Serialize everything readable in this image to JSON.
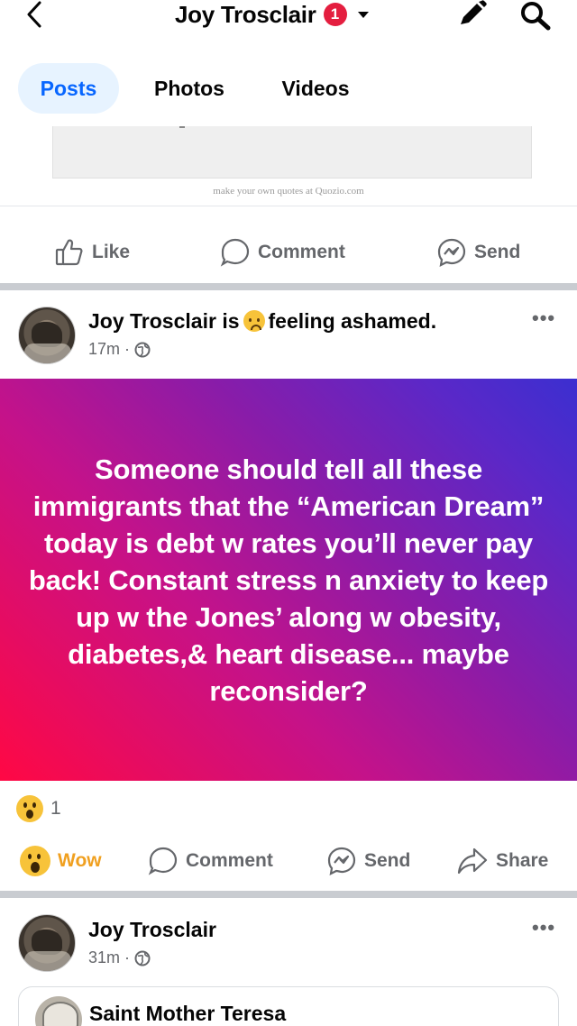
{
  "header": {
    "title": "Joy Trosclair",
    "notification_count": "1"
  },
  "tabs": [
    "Posts",
    "Photos",
    "Videos"
  ],
  "previous_post": {
    "credit": "make your own quotes at Quozio.com",
    "actions": {
      "like": "Like",
      "comment": "Comment",
      "send": "Send"
    }
  },
  "post1": {
    "author": "Joy Trosclair",
    "is_text": "is",
    "feeling": "feeling ashamed.",
    "time": "17m ·",
    "body": "Someone should tell all these immigrants that the “American Dream” today is debt w rates you’ll never pay back! Constant stress n anxiety to keep up w the Jones’ along w obesity, diabetes,& heart disease... maybe reconsider?",
    "reaction_count": "1",
    "actions": {
      "wow": "Wow",
      "comment": "Comment",
      "send": "Send",
      "share": "Share"
    }
  },
  "post2": {
    "author": "Joy Trosclair",
    "time": "31m ·",
    "shared_name": "Saint Mother Teresa"
  },
  "colors": {
    "accent": "#0866ff",
    "tab_bg": "#e7f3ff",
    "badge": "#e41e3f",
    "gradient_start": "#ff0844",
    "gradient_end": "#3b2fd0",
    "wow_label": "#f0a020"
  }
}
